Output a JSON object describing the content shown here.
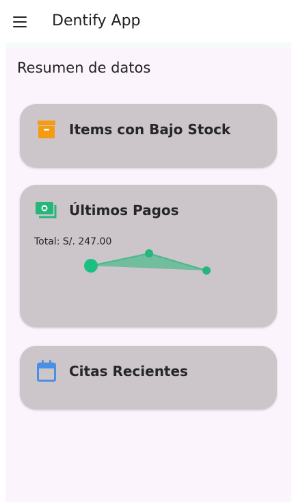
{
  "appbar": {
    "title": "Dentify App",
    "menu_icon": "menu-icon"
  },
  "main": {
    "section_title": "Resumen de datos",
    "cards": {
      "low_stock": {
        "title": "Items con Bajo Stock",
        "icon": "archive-box-icon",
        "color": "#f39c12"
      },
      "payments": {
        "title": "Últimos Pagos",
        "icon": "money-icon",
        "color": "#27b67a",
        "total_label": "Total: S/. 247.00"
      },
      "appointments": {
        "title": "Citas Recientes",
        "icon": "calendar-icon",
        "color": "#4a90e2"
      }
    }
  },
  "chart_data": {
    "type": "line",
    "values": [
      null,
      null,
      null
    ],
    "series_color": "#27b67a"
  },
  "colors": {
    "card_bg": "#ccc5ca",
    "page_bg": "#fcf4fd"
  }
}
